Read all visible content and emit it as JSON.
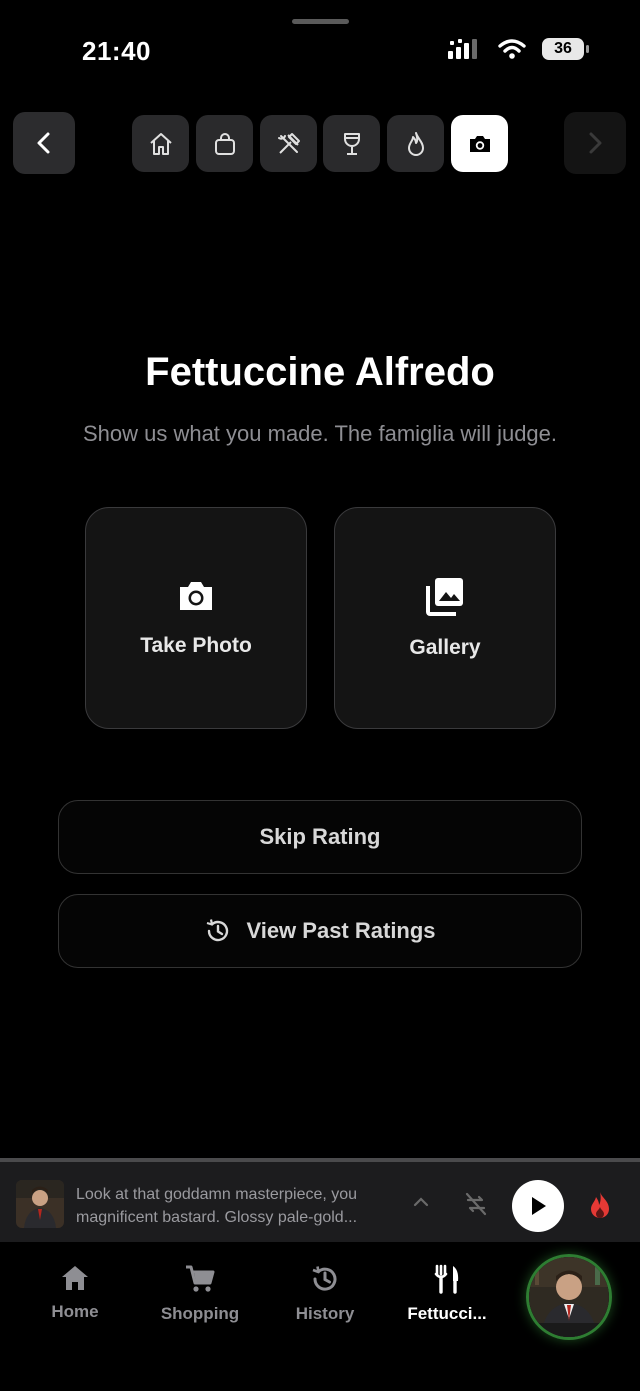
{
  "status_bar": {
    "time": "21:40",
    "battery": "36"
  },
  "step_nav": {
    "steps": [
      {
        "icon": "home-icon",
        "active": false
      },
      {
        "icon": "shopping-bag-icon",
        "active": false
      },
      {
        "icon": "tools-icon",
        "active": false
      },
      {
        "icon": "wine-glass-icon",
        "active": false
      },
      {
        "icon": "flame-icon",
        "active": false
      },
      {
        "icon": "camera-icon",
        "active": true
      }
    ]
  },
  "main": {
    "title": "Fettuccine Alfredo",
    "subtitle": "Show us what you made. The famiglia will judge.",
    "take_photo_label": "Take Photo",
    "gallery_label": "Gallery",
    "skip_rating_label": "Skip Rating",
    "view_past_ratings_label": "View Past Ratings"
  },
  "player": {
    "line1": "Look at that goddamn masterpiece, you",
    "line2": "magnificent bastard. Glossy pale-gold..."
  },
  "tabs": [
    {
      "label": "Home",
      "icon": "home-icon"
    },
    {
      "label": "Shopping",
      "icon": "cart-icon"
    },
    {
      "label": "History",
      "icon": "history-icon"
    },
    {
      "label": "Fettucci...",
      "icon": "fork-knife-icon",
      "active": true
    }
  ],
  "colors": {
    "accent_green": "#2e7d32",
    "flame_red": "#e53935",
    "background": "#000000"
  }
}
